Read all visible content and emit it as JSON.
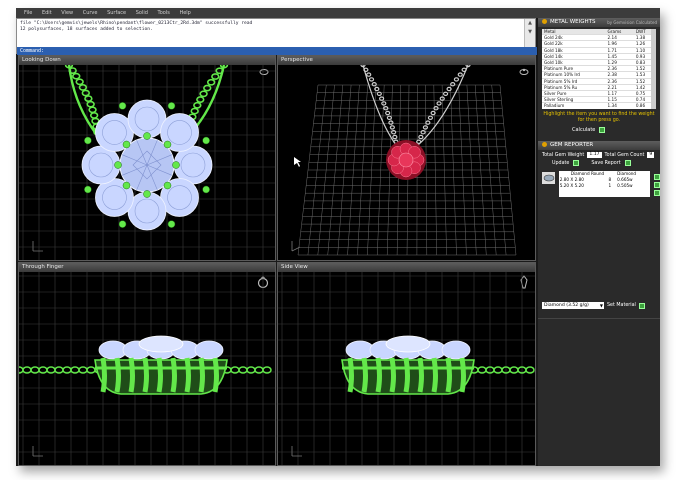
{
  "menubar": {
    "items": [
      "File",
      "Edit",
      "View",
      "Curve",
      "Surface",
      "Solid",
      "Tools",
      "Help"
    ]
  },
  "command": {
    "history": [
      "file \"C:\\Users\\gemvis\\jewels\\Rhino\\pendant\\flower_0213Ctr_2Rd.3dm\" successfully read",
      "12 polysurfaces, 18 surfaces added to selection."
    ],
    "prompt": "Command:"
  },
  "viewports": [
    {
      "title": "Looking Down"
    },
    {
      "title": "Perspective"
    },
    {
      "title": "Through Finger"
    },
    {
      "title": "Side View"
    }
  ],
  "metal_weights": {
    "title": "METAL WEIGHTS",
    "subtitle": "by Gemvision Calculated",
    "columns": [
      "Metal",
      "Grams",
      "DWT"
    ],
    "rows": [
      [
        "Gold 24k",
        "2.14",
        "1.38"
      ],
      [
        "Gold 22k",
        "1.96",
        "1.26"
      ],
      [
        "Gold 18k",
        "1.71",
        "1.10"
      ],
      [
        "Gold 14k",
        "1.45",
        "0.93"
      ],
      [
        "Gold 10k",
        "1.29",
        "0.83"
      ],
      [
        "Platinum Pure",
        "2.36",
        "1.52"
      ],
      [
        "Platinum 10% Ird",
        "2.38",
        "1.53"
      ],
      [
        "Platinum 5% Ird",
        "2.36",
        "1.52"
      ],
      [
        "Platinum 5% Ru",
        "2.21",
        "1.42"
      ],
      [
        "Silver Pure",
        "1.17",
        "0.75"
      ],
      [
        "Silver Sterling",
        "1.15",
        "0.74"
      ],
      [
        "Palladium",
        "1.34",
        "0.86"
      ]
    ],
    "note": "Highlight the item you want to find the weight for then press go.",
    "calculate_label": "Calculate"
  },
  "gem_reporter": {
    "title": "GEM REPORTER",
    "total_weight_label": "Total Gem Weight",
    "total_weight_value": "1.17",
    "total_count_label": "Total Gem Count",
    "total_count_value": "9",
    "update_label": "Update",
    "save_report_label": "Save Report",
    "gems": [
      {
        "shape": "Diamond Round",
        "material": "Diamond"
      },
      {
        "size": "2.80 X 2.80",
        "count": "8",
        "weight": "0.665w"
      },
      {
        "size": "5.20 X 5.20",
        "count": "1",
        "weight": "0.505w"
      }
    ]
  },
  "material": {
    "selected": "Diamond  (3.52 g/g)",
    "set_label": "Set Material"
  },
  "colors": {
    "wire": "#63e84a",
    "gem_blue": "#c9d6ff",
    "ruby": "#d02040",
    "grid": "#8a8a8a",
    "accent": "#e6c200"
  }
}
